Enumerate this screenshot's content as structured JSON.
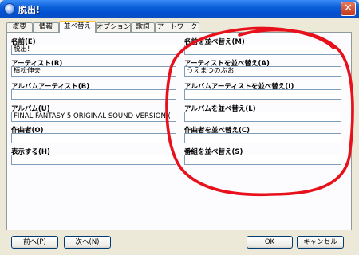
{
  "window": {
    "title": "脱出!"
  },
  "tabs": [
    {
      "label": "概要"
    },
    {
      "label": "情報"
    },
    {
      "label": "並べ替え"
    },
    {
      "label": "オプション"
    },
    {
      "label": "歌詞"
    },
    {
      "label": "アートワーク"
    }
  ],
  "left_fields": [
    {
      "label": "名前(E)",
      "value": "脱出!"
    },
    {
      "label": "アーティスト(R)",
      "value": "植松伸夫"
    },
    {
      "label": "アルバムアーティスト(B)",
      "value": ""
    },
    {
      "label": "アルバム(U)",
      "value": "FINAL FANTASY  5 ORIGINAL SOUND VERSION ("
    },
    {
      "label": "作曲者(O)",
      "value": ""
    },
    {
      "label": "表示する(H)",
      "value": ""
    }
  ],
  "right_fields": [
    {
      "label": "名前を並べ替え(M)",
      "value": ""
    },
    {
      "label": "アーティストを並べ替え(A)",
      "value": "うえまつのぶお"
    },
    {
      "label": "アルバムアーティストを並べ替え(I)",
      "value": ""
    },
    {
      "label": "アルバムを並べ替え(L)",
      "value": ""
    },
    {
      "label": "作曲者を並べ替え(C)",
      "value": ""
    },
    {
      "label": "番組を並べ替え(S)",
      "value": ""
    }
  ],
  "buttons": {
    "prev": "前へ(P)",
    "next": "次へ(N)",
    "ok": "OK",
    "cancel": "キャンセル"
  },
  "colors": {
    "titlebar": "#0a5fd8",
    "annotation": "#e8101a",
    "dialog": "#ece9d8"
  }
}
